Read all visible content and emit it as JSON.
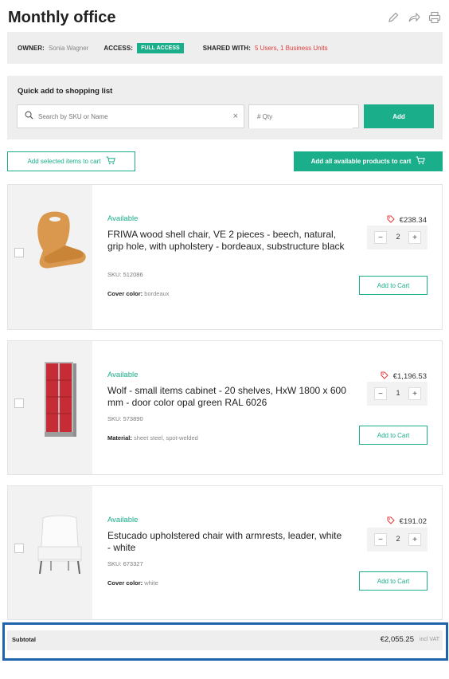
{
  "header": {
    "title": "Monthly office",
    "icons": [
      "pencil-icon",
      "share-icon",
      "print-icon"
    ]
  },
  "info": {
    "owner_label": "OWNER:",
    "owner_value": "Sonia Wagner",
    "access_label": "ACCESS:",
    "access_value": "FULL ACCESS",
    "shared_label": "SHARED WITH:",
    "shared_value": "5 Users, 1 Business Units"
  },
  "quick_add": {
    "title": "Quick add to shopping list",
    "search_placeholder": "Search by SKU or Name",
    "qty_placeholder": "# Qty",
    "add_label": "Add"
  },
  "actions": {
    "add_selected": "Add selected items to cart",
    "add_all": "Add all available products to cart"
  },
  "items": [
    {
      "status": "Available",
      "name": "FRIWA wood shell chair, VE 2 pieces - beech, natural, grip hole, with upholstery - bordeaux, substructure black",
      "sku": "SKU: 512086",
      "attr_label": "Cover color:",
      "attr_value": "bordeaux",
      "price": "€238.34",
      "qty": "2",
      "cart_label": "Add to Cart"
    },
    {
      "status": "Available",
      "name": "Wolf - small items cabinet - 20 shelves, HxW 1800 x 600 mm - door color opal green RAL 6026",
      "sku": "SKU: 573890",
      "attr_label": "Material:",
      "attr_value": "sheet steel, spot-welded",
      "price": "€1,196.53",
      "qty": "1",
      "cart_label": "Add to Cart"
    },
    {
      "status": "Available",
      "name": "Estucado upholstered chair with armrests, leader, white - white",
      "sku": "SKU: 673327",
      "attr_label": "Cover color:",
      "attr_value": "white",
      "price": "€191.02",
      "qty": "2",
      "cart_label": "Add to Cart"
    }
  ],
  "subtotal": {
    "label": "Subtotal",
    "value": "€2,055.25",
    "vat": "incl VAT"
  },
  "colors": {
    "accent": "#1aae8b",
    "danger": "#e03a3a",
    "highlight": "#1d64ad"
  }
}
